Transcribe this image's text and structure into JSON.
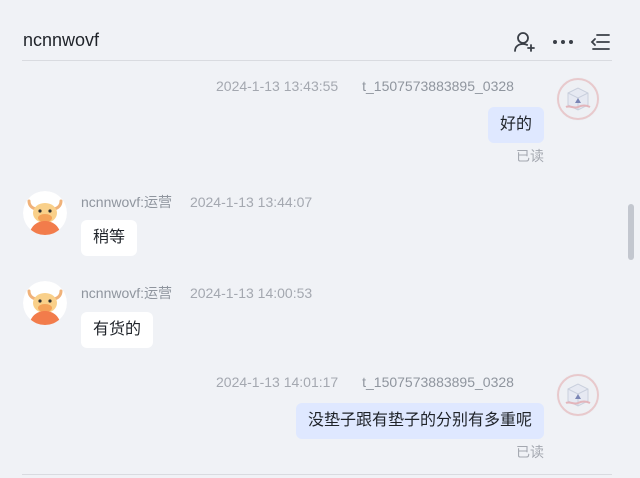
{
  "header": {
    "title": "ncnnwovf",
    "icons": [
      "user-add-icon",
      "more-icon",
      "menu-icon"
    ]
  },
  "messages": [
    {
      "direction": "out",
      "time": "2024-1-13 13:43:55",
      "sender": "t_1507573883895_0328",
      "text": "好的",
      "status": "已读"
    },
    {
      "direction": "in",
      "sender": "ncnnwovf:运营",
      "time": "2024-1-13 13:44:07",
      "text": "稍等"
    },
    {
      "direction": "in",
      "sender": "ncnnwovf:运营",
      "time": "2024-1-13 14:00:53",
      "text": "有货的"
    },
    {
      "direction": "out",
      "time": "2024-1-13 14:01:17",
      "sender": "t_1507573883895_0328",
      "text": "没垫子跟有垫子的分别有多重呢",
      "status": "已读"
    }
  ],
  "colors": {
    "background": "#f0f2f6",
    "outgoing_bubble": "#dfe8ff",
    "incoming_bubble": "#ffffff",
    "avatar_orange": "#f27c4b"
  }
}
